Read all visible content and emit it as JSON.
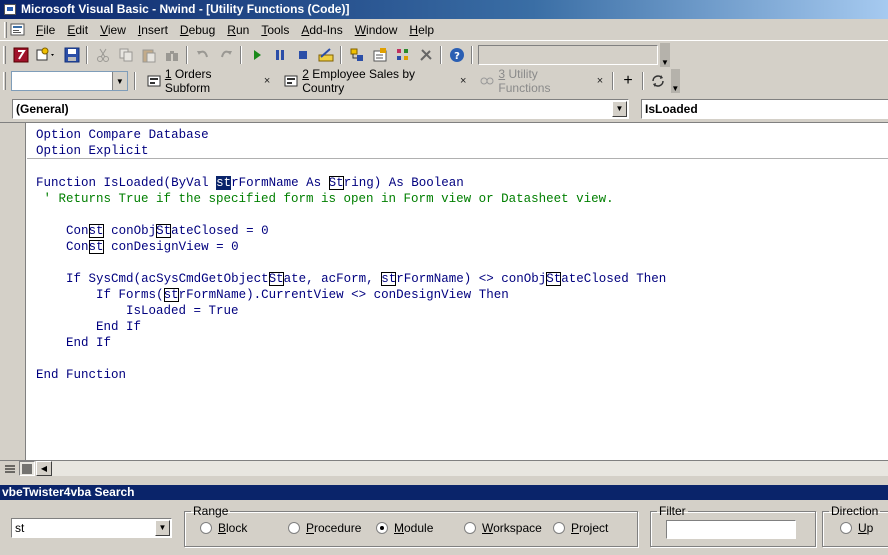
{
  "window": {
    "title": "Microsoft Visual Basic - Nwind - [Utility Functions (Code)]"
  },
  "menu": [
    {
      "id": "file",
      "label": "File",
      "accel": "F",
      "rest": "ile"
    },
    {
      "id": "edit",
      "label": "Edit",
      "accel": "E",
      "rest": "dit"
    },
    {
      "id": "view",
      "label": "View",
      "accel": "V",
      "rest": "iew"
    },
    {
      "id": "insert",
      "label": "Insert",
      "accel": "I",
      "rest": "nsert"
    },
    {
      "id": "debug",
      "label": "Debug",
      "accel": "D",
      "rest": "ebug"
    },
    {
      "id": "run",
      "label": "Run",
      "accel": "R",
      "rest": "un"
    },
    {
      "id": "tools",
      "label": "Tools",
      "accel": "T",
      "rest": "ools"
    },
    {
      "id": "addins",
      "label": "Add-Ins",
      "accel": "A",
      "rest": "dd-Ins"
    },
    {
      "id": "window",
      "label": "Window",
      "accel": "W",
      "rest": "indow"
    },
    {
      "id": "help",
      "label": "Help",
      "accel": "H",
      "rest": "elp"
    }
  ],
  "doc_tabs": [
    {
      "num": "1",
      "label": " Orders Subform",
      "close": "×",
      "active": true
    },
    {
      "num": "2",
      "label": " Employee Sales by Country",
      "close": "×",
      "active": true
    },
    {
      "num": "3",
      "label": " Utility Functions",
      "close": "×",
      "active": false
    }
  ],
  "toolbar2": {
    "plus": "+"
  },
  "procedure_bar": {
    "object": "(General)",
    "procedure": "IsLoaded"
  },
  "code_lines": [
    "Option Compare Database",
    "Option Explicit",
    "",
    "Function IsLoaded(ByVal strFormName As String) As Boolean",
    " ' Returns True if the specified form is open in Form view or Datasheet view.",
    "",
    "    Const conObjStateClosed = 0",
    "    Const conDesignView = 0",
    "",
    "    If SysCmd(acSysCmdGetObjectState, acForm, strFormName) <> conObjStateClosed Then",
    "        If Forms(strFormName).CurrentView <> conDesignView Then",
    "            IsLoaded = True",
    "        End If",
    "    End If",
    "",
    "End Function"
  ],
  "search": {
    "title": "vbeTwister4vba Search",
    "query": "st",
    "range_label": "Range",
    "range_options": [
      {
        "label": "Block",
        "accel": "B",
        "rest": "lock",
        "checked": false
      },
      {
        "label": "Procedure",
        "accel": "P",
        "rest": "rocedure",
        "checked": false
      },
      {
        "label": "Module",
        "accel": "M",
        "rest": "odule",
        "checked": true
      },
      {
        "label": "Workspace",
        "accel": "W",
        "rest": "orkspace",
        "checked": false
      },
      {
        "label": "Project",
        "accel": "P",
        "rest": "roject",
        "checked": false
      }
    ],
    "filter_label": "Filter",
    "filter_value": "",
    "direction_label": "Direction",
    "direction_option": {
      "label": "Up",
      "accel": "U",
      "rest": "p",
      "checked": false
    }
  },
  "colors": {
    "keyword": "#00007f",
    "comment": "#007f00",
    "title_bar": "#0a246a",
    "selection": "#0a246a"
  }
}
